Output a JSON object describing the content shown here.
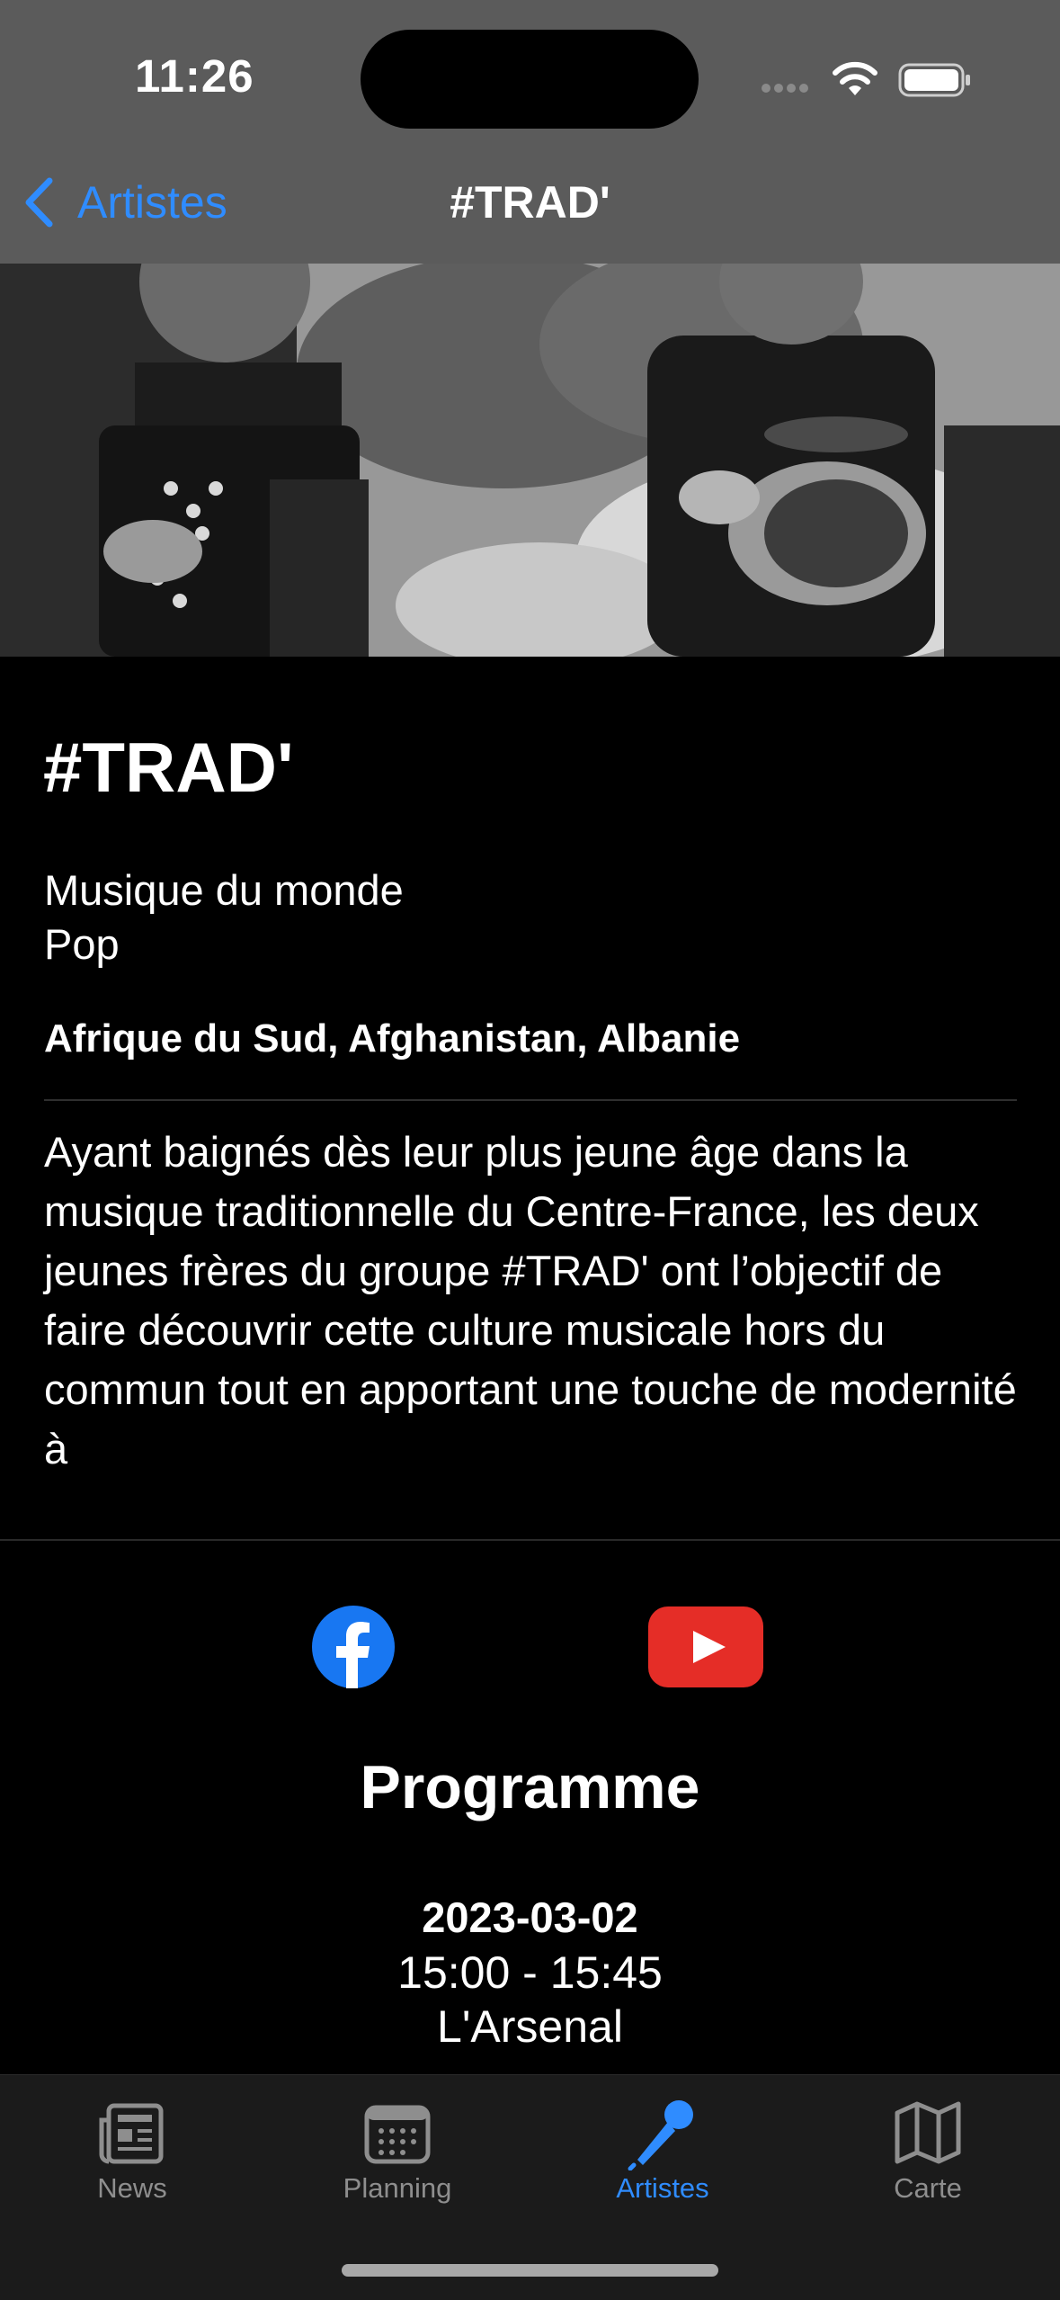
{
  "status_bar": {
    "time": "11:26"
  },
  "nav": {
    "back_label": "Artistes",
    "title": "#TRAD'"
  },
  "hero_image": {
    "alt": "#TRAD'"
  },
  "artist": {
    "name": "#TRAD'",
    "genres": [
      "Musique du monde",
      "Pop"
    ],
    "countries": "Afrique du Sud, Afghanistan, Albanie",
    "description": "Ayant baignés dès leur plus jeune âge dans la musique traditionnelle du Centre-France, les deux jeunes frères du groupe #TRAD' ont l’objectif de faire découvrir cette culture musicale hors du commun tout en apportant une touche de modernité à"
  },
  "social": [
    {
      "icon": "facebook-icon",
      "color": "#1877f2"
    },
    {
      "icon": "youtube-icon",
      "color": "#e52d27"
    }
  ],
  "programme": {
    "title": "Programme",
    "date": "2023-03-02",
    "time": "15:00 - 15:45",
    "venue": "L'Arsenal"
  },
  "tabs": [
    {
      "label": "News",
      "icon": "newspaper-icon",
      "active": false
    },
    {
      "label": "Planning",
      "icon": "calendar-icon",
      "active": false
    },
    {
      "label": "Artistes",
      "icon": "microphone-icon",
      "active": true
    },
    {
      "label": "Carte",
      "icon": "map-icon",
      "active": false
    }
  ],
  "colors": {
    "accent": "#2f8cff",
    "inactive": "#8e8e8e",
    "tabbar": "#1b1b1b",
    "background": "#000000"
  }
}
